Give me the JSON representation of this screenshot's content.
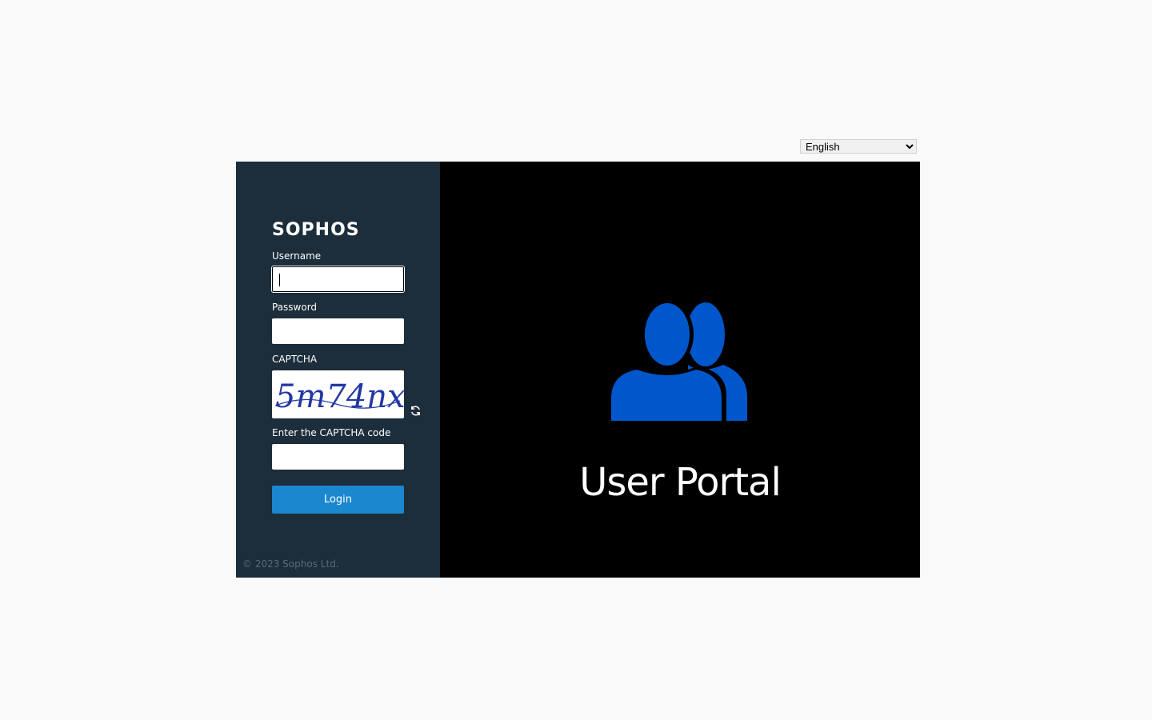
{
  "language_select": {
    "selected": "English",
    "options": [
      "English"
    ]
  },
  "login_form": {
    "logo_text": "SOPHOS",
    "username_label": "Username",
    "username_value": "",
    "password_label": "Password",
    "password_value": "",
    "captcha_label": "CAPTCHA",
    "captcha_image_text": "5m74nx",
    "captcha_code_label": "Enter the CAPTCHA code",
    "captcha_code_value": "",
    "login_button_label": "Login",
    "copyright": "© 2023 Sophos Ltd."
  },
  "hero": {
    "title": "User Portal",
    "icon": "users-icon"
  },
  "colors": {
    "page_background": "#f9f9f9",
    "left_panel": "#1c2d3b",
    "right_panel": "#000000",
    "login_button": "#1a87cf",
    "users_icon": "#0057cc",
    "captcha_text": "#2237a3",
    "copyright_text": "#5c6b7a"
  }
}
